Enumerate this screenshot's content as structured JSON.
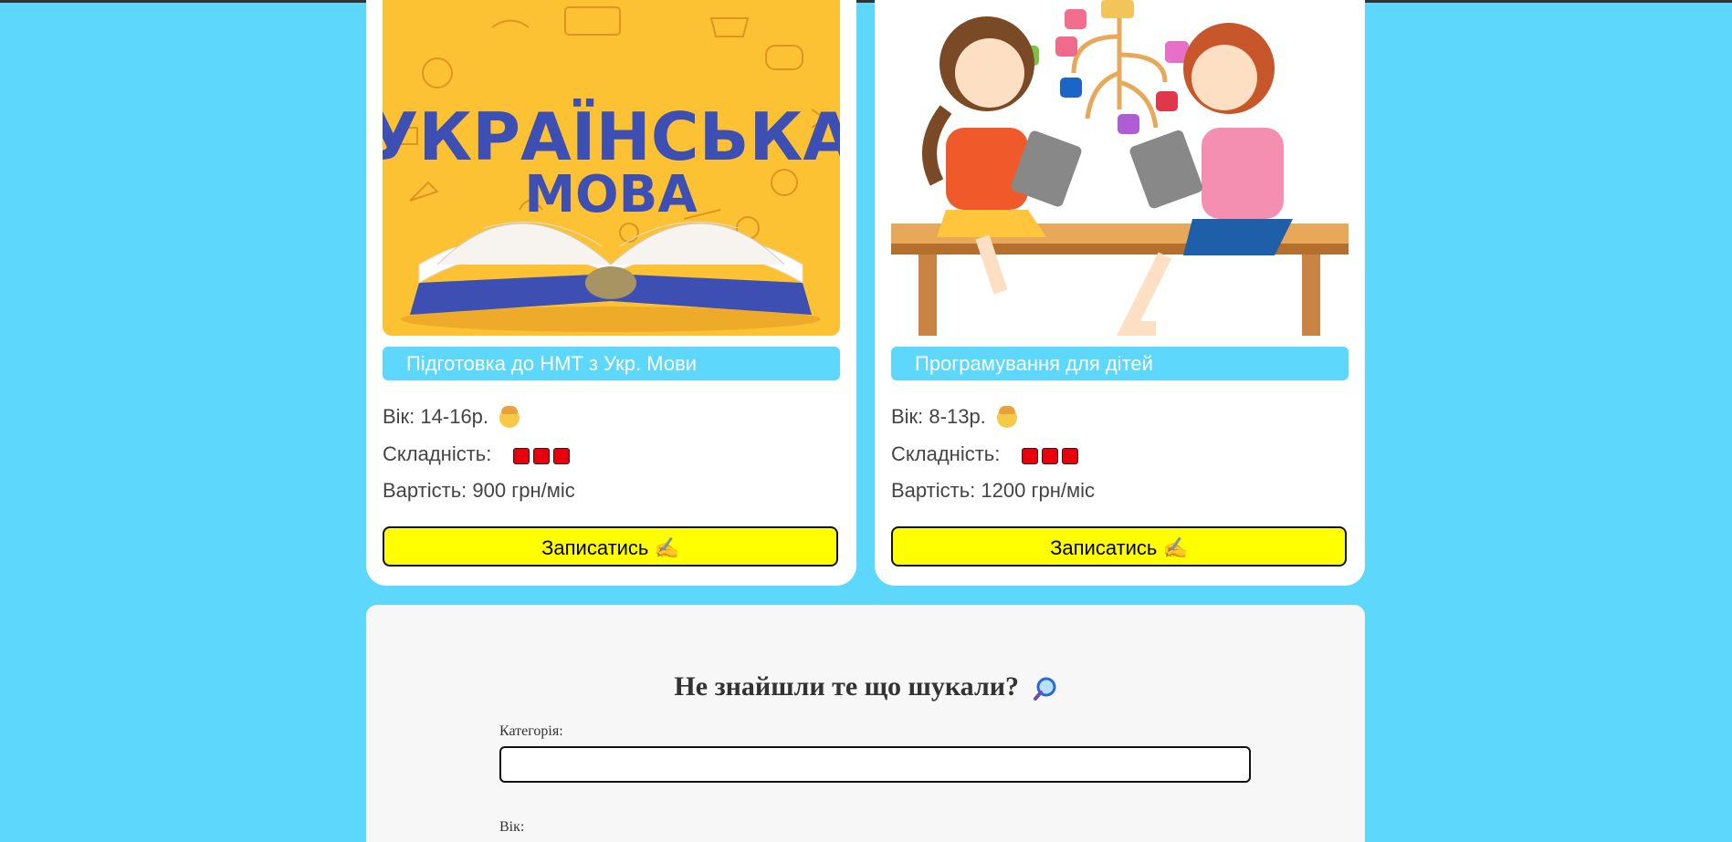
{
  "courses": [
    {
      "image_alt": "УКРАЇНСЬКА МОВА",
      "image_title_line1": "УКРАЇНСЬКА",
      "image_title_line2": "МОВА",
      "title": "Підготовка до НМТ з Укр. Мови",
      "age": "Вік: 14-16р.",
      "difficulty_label": "Складність:",
      "difficulty_level": 3,
      "price": "Вартість: 900 грн/міс",
      "button": "Записатись ✍️"
    },
    {
      "title": "Програмування для дітей",
      "age": "Вік: 8-13р.",
      "difficulty_label": "Складність:",
      "difficulty_level": 3,
      "price": "Вартість: 1200 грн/міс",
      "button": "Записатись ✍️"
    }
  ],
  "search": {
    "title": "Не знайшли те що шукали?",
    "category_label": "Категорія:",
    "category_value": "",
    "age_label": "Вік:"
  },
  "colors": {
    "background": "#5dd8fc",
    "button": "#ffff00",
    "difficulty": "#e8000c"
  }
}
